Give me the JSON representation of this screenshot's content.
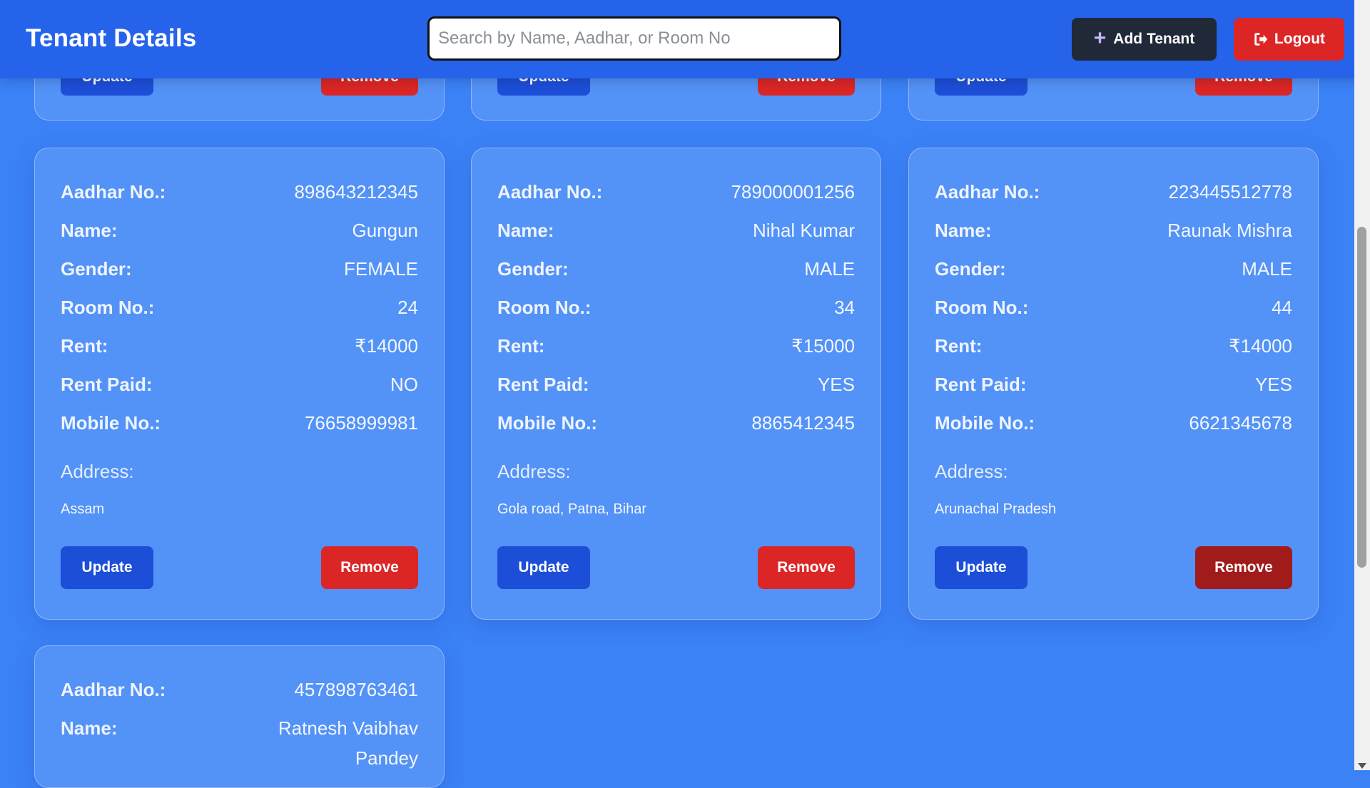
{
  "header": {
    "title": "Tenant Details",
    "search_placeholder": "Search by Name, Aadhar, or Room No",
    "search_value": "",
    "add_label": "Add Tenant",
    "logout_label": "Logout"
  },
  "labels": {
    "aadhar": "Aadhar No.:",
    "name": "Name:",
    "gender": "Gender:",
    "room": "Room No.:",
    "rent": "Rent:",
    "rent_paid": "Rent Paid:",
    "mobile": "Mobile No.:",
    "address": "Address:",
    "update": "Update",
    "remove": "Remove"
  },
  "tenants": [
    {
      "aadhar": "898643212345",
      "name": "Gungun",
      "gender": "FEMALE",
      "room": "24",
      "rent": "₹14000",
      "rent_paid": "NO",
      "mobile": "76658999981",
      "address": "Assam"
    },
    {
      "aadhar": "789000001256",
      "name": "Nihal Kumar",
      "gender": "MALE",
      "room": "34",
      "rent": "₹15000",
      "rent_paid": "YES",
      "mobile": "8865412345",
      "address": "Gola road, Patna, Bihar"
    },
    {
      "aadhar": "223445512778",
      "name": "Raunak Mishra",
      "gender": "MALE",
      "room": "44",
      "rent": "₹14000",
      "rent_paid": "YES",
      "mobile": "6621345678",
      "address": "Arunachal Pradesh"
    },
    {
      "aadhar": "457898763461",
      "name": "Ratnesh Vaibhav Pandey"
    }
  ]
}
